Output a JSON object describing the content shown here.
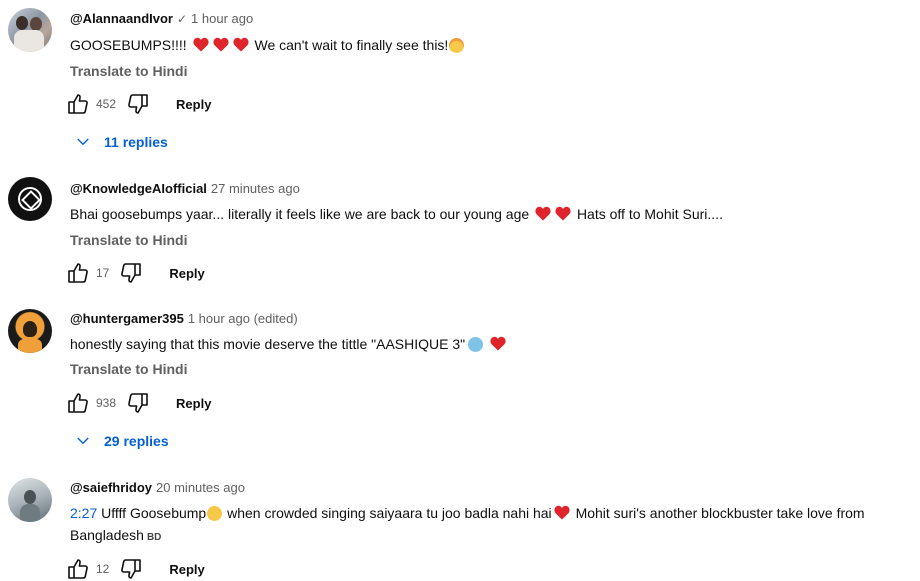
{
  "comments": [
    {
      "author": "@AlannaandIvor",
      "time": "1 hour ago",
      "text_parts": [
        "GOOSEBUMPS!!!!",
        "We can't wait to finally see this!"
      ],
      "translate": "Translate to Hindi",
      "likes": "452",
      "reply": "Reply",
      "replies": "11 replies",
      "verified": true
    },
    {
      "author": "@KnowledgeAIofficial",
      "time": "27 minutes ago",
      "text_parts": [
        "Bhai goosebumps yaar... literally it feels like we are back to our young age",
        "Hats off to Mohit Suri...."
      ],
      "translate": "Translate to Hindi",
      "likes": "17",
      "reply": "Reply"
    },
    {
      "author": "@huntergamer395",
      "time": "1 hour ago (edited)",
      "text_parts": [
        "honestly saying that this movie deserve the tittle \"AASHIQUE 3\""
      ],
      "translate": "Translate to Hindi",
      "likes": "938",
      "reply": "Reply",
      "replies": "29 replies"
    },
    {
      "author": "@saiefhridoy",
      "time": "20 minutes ago",
      "timestamp_link": "2:27",
      "text_parts": [
        "Uffff Goosebump",
        "when crowded singing saiyaara tu joo badla nahi hai",
        "Mohit suri's another blockbuster take love",
        "from Bangladesh",
        "BD"
      ],
      "likes": "12",
      "reply": "Reply"
    }
  ],
  "icons": {
    "like": "thumb-up-icon",
    "dislike": "thumb-down-icon",
    "expand": "chevron-down-icon",
    "heart": "red-heart-emoji",
    "verified": "check-icon"
  },
  "colors": {
    "link": "#065fd4",
    "secondary": "#606060",
    "heart": "#e0242b"
  }
}
